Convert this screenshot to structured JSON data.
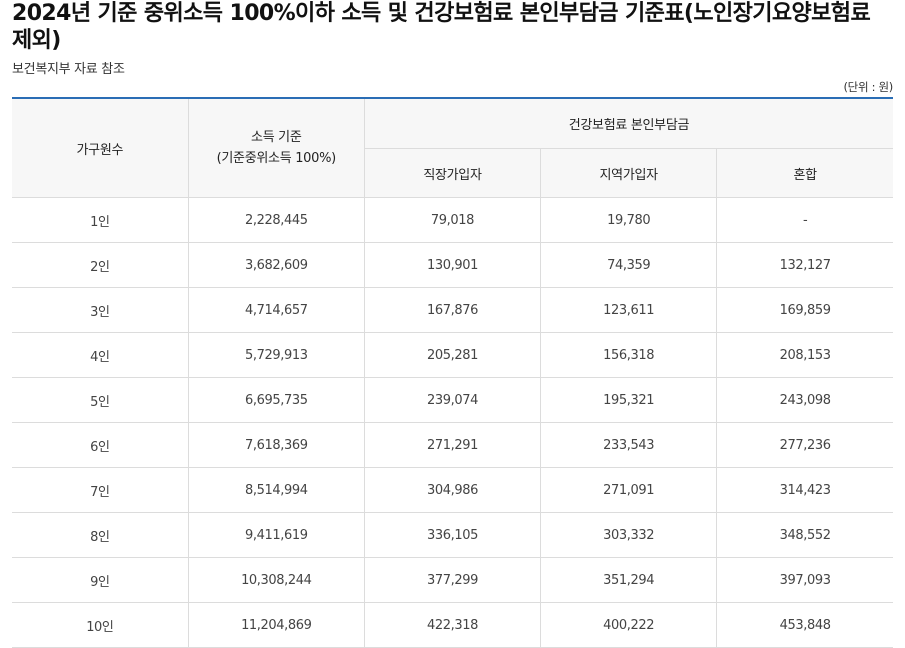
{
  "title": "2024년 기준 중위소득 100%이하 소득 및 건강보험료 본인부담금 기준표(노인장기요양보험료 제외)",
  "source": "보건복지부 자료 참조",
  "unit": "(단위 : 원)",
  "header": {
    "household": "가구원수",
    "income_line1": "소득 기준",
    "income_line2": "(기준중위소득 100%)",
    "premium_group": "건강보험료 본인부담금",
    "employee": "직장가입자",
    "regional": "지역가입자",
    "mixed": "혼합"
  },
  "rows": [
    {
      "household": "1인",
      "income": "2,228,445",
      "employee": "79,018",
      "regional": "19,780",
      "mixed": "-"
    },
    {
      "household": "2인",
      "income": "3,682,609",
      "employee": "130,901",
      "regional": "74,359",
      "mixed": "132,127"
    },
    {
      "household": "3인",
      "income": "4,714,657",
      "employee": "167,876",
      "regional": "123,611",
      "mixed": "169,859"
    },
    {
      "household": "4인",
      "income": "5,729,913",
      "employee": "205,281",
      "regional": "156,318",
      "mixed": "208,153"
    },
    {
      "household": "5인",
      "income": "6,695,735",
      "employee": "239,074",
      "regional": "195,321",
      "mixed": "243,098"
    },
    {
      "household": "6인",
      "income": "7,618,369",
      "employee": "271,291",
      "regional": "233,543",
      "mixed": "277,236"
    },
    {
      "household": "7인",
      "income": "8,514,994",
      "employee": "304,986",
      "regional": "271,091",
      "mixed": "314,423"
    },
    {
      "household": "8인",
      "income": "9,411,619",
      "employee": "336,105",
      "regional": "303,332",
      "mixed": "348,552"
    },
    {
      "household": "9인",
      "income": "10,308,244",
      "employee": "377,299",
      "regional": "351,294",
      "mixed": "397,093"
    },
    {
      "household": "10인",
      "income": "11,204,869",
      "employee": "422,318",
      "regional": "400,222",
      "mixed": "453,848"
    }
  ],
  "colors": {
    "accent_line": "#2a6db5",
    "header_bg": "#f7f7f7",
    "border": "#dcdcdc"
  }
}
